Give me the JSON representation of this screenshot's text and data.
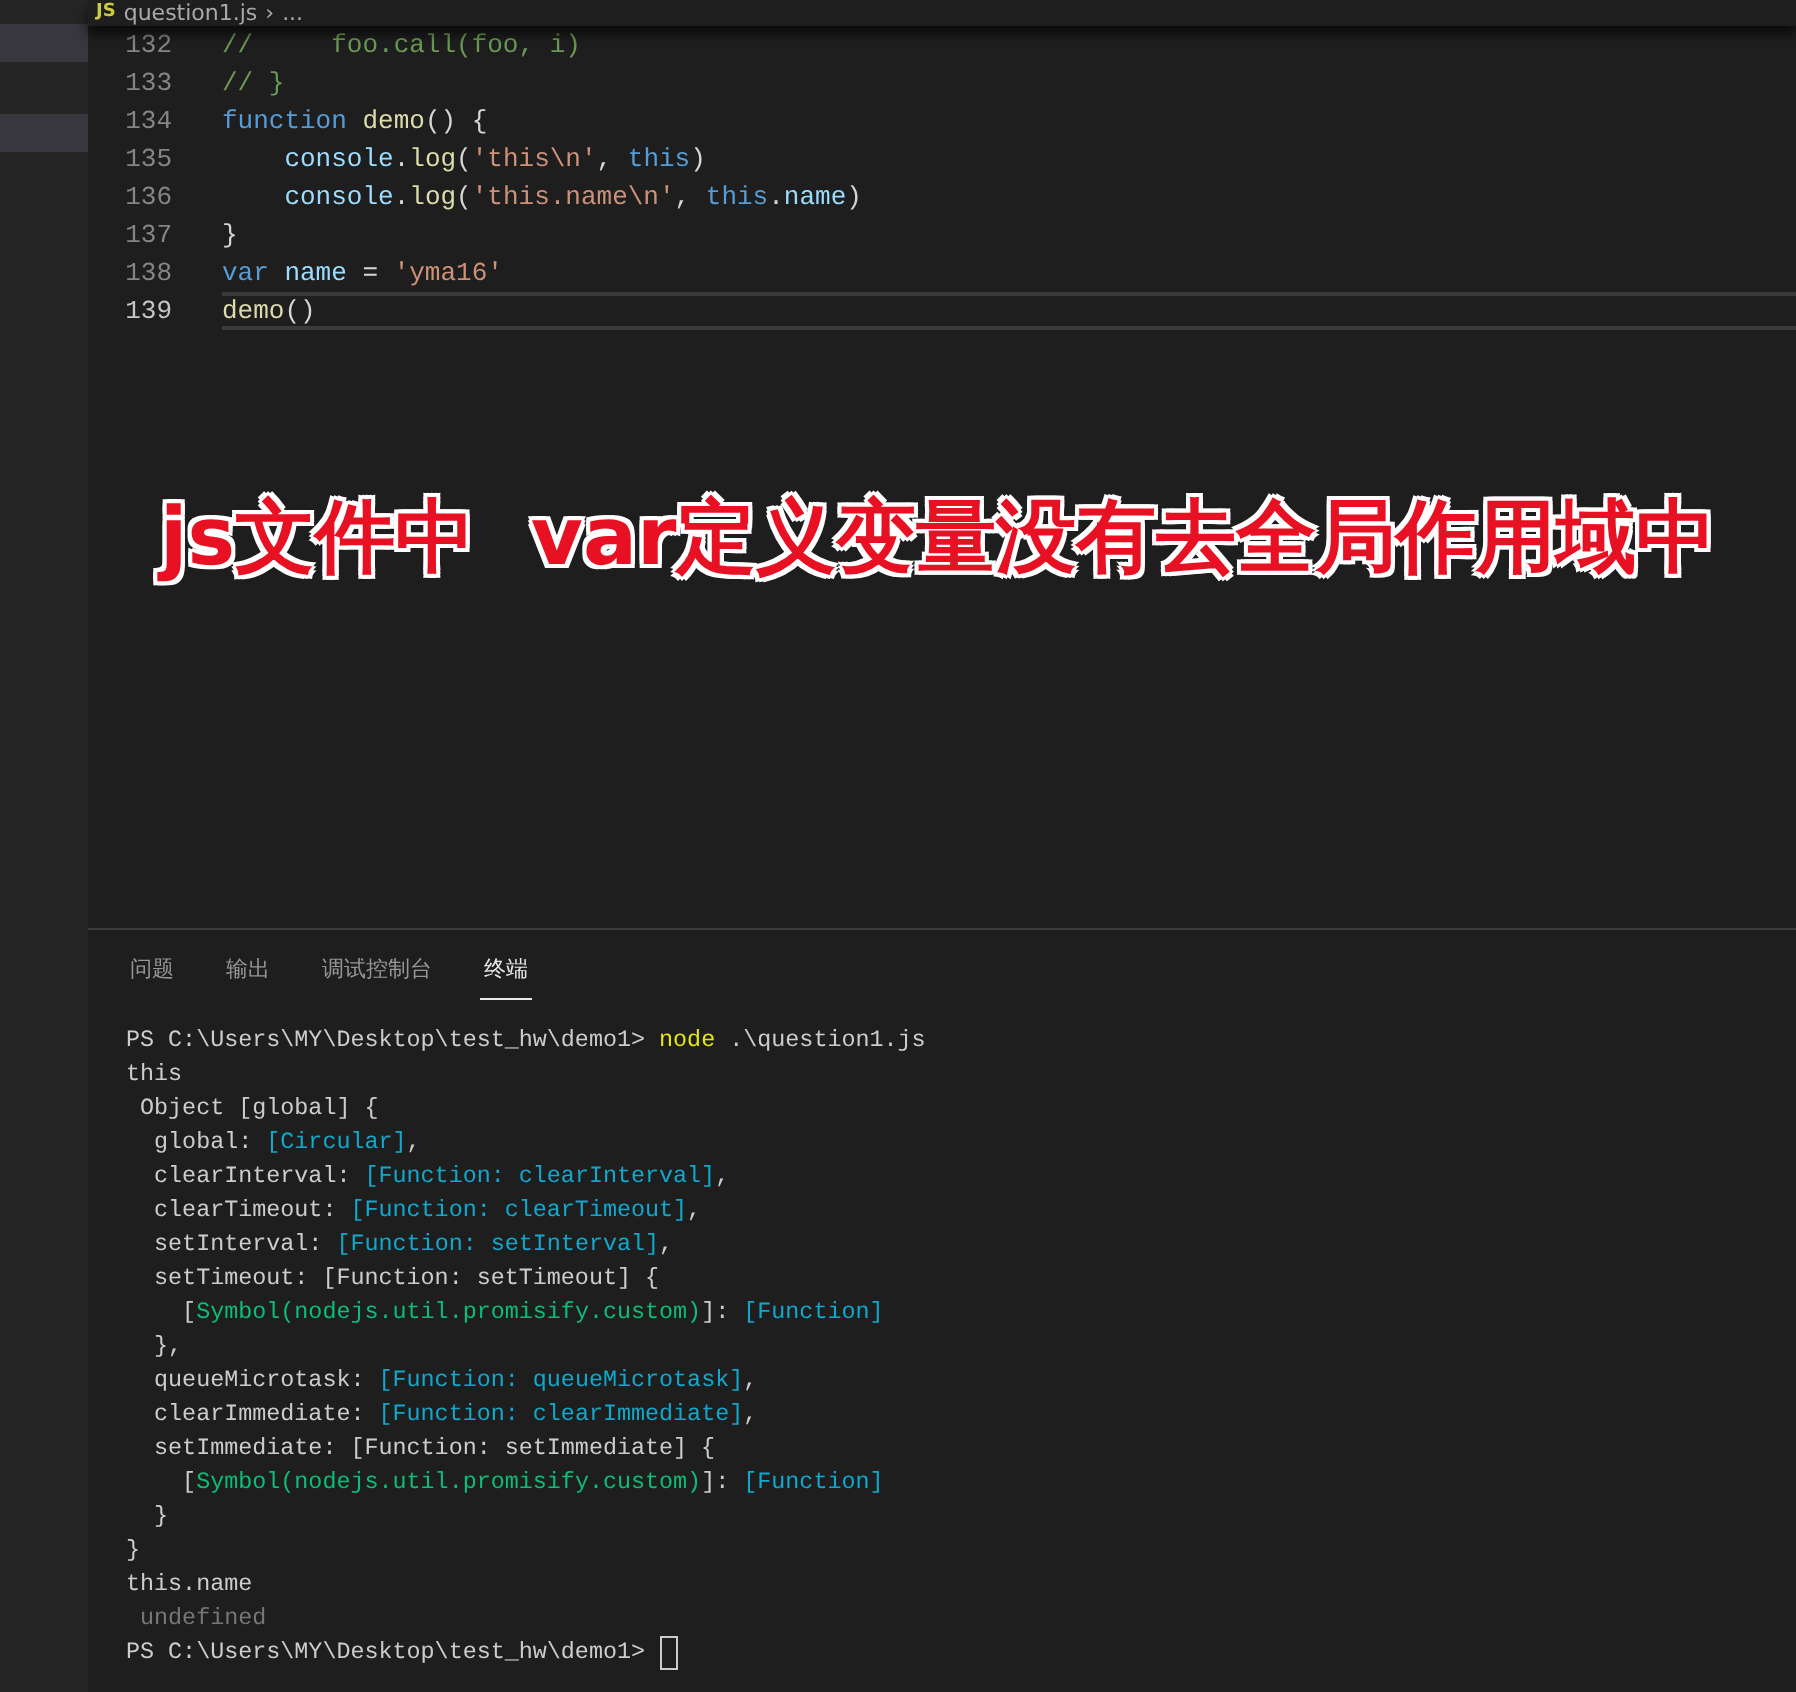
{
  "breadcrumb": {
    "icon": "JS",
    "file": "question1.js",
    "separator": "›",
    "more": "..."
  },
  "editor": {
    "lines": [
      {
        "number": "132",
        "current": false,
        "tokens": [
          {
            "kind": "comment",
            "text": "//     foo.call(foo, i)"
          }
        ]
      },
      {
        "number": "133",
        "current": false,
        "tokens": [
          {
            "kind": "comment",
            "text": "// }"
          }
        ]
      },
      {
        "number": "134",
        "current": false,
        "tokens": [
          {
            "kind": "keyword",
            "text": "function"
          },
          {
            "kind": "func",
            "text": " demo"
          },
          {
            "kind": "plain",
            "text": "() {"
          }
        ]
      },
      {
        "number": "135",
        "current": false,
        "tokens": [
          {
            "kind": "var",
            "text": "    console"
          },
          {
            "kind": "plain",
            "text": "."
          },
          {
            "kind": "func",
            "text": "log"
          },
          {
            "kind": "plain",
            "text": "("
          },
          {
            "kind": "string",
            "text": "'this\\n'"
          },
          {
            "kind": "plain",
            "text": ", "
          },
          {
            "kind": "keyword",
            "text": "this"
          },
          {
            "kind": "plain",
            "text": ")"
          }
        ]
      },
      {
        "number": "136",
        "current": false,
        "tokens": [
          {
            "kind": "var",
            "text": "    console"
          },
          {
            "kind": "plain",
            "text": "."
          },
          {
            "kind": "func",
            "text": "log"
          },
          {
            "kind": "plain",
            "text": "("
          },
          {
            "kind": "string",
            "text": "'this.name\\n'"
          },
          {
            "kind": "plain",
            "text": ", "
          },
          {
            "kind": "keyword",
            "text": "this"
          },
          {
            "kind": "plain",
            "text": "."
          },
          {
            "kind": "var",
            "text": "name"
          },
          {
            "kind": "plain",
            "text": ")"
          }
        ]
      },
      {
        "number": "137",
        "current": false,
        "tokens": [
          {
            "kind": "plain",
            "text": "}"
          }
        ]
      },
      {
        "number": "138",
        "current": false,
        "tokens": [
          {
            "kind": "keyword",
            "text": "var"
          },
          {
            "kind": "var",
            "text": " name"
          },
          {
            "kind": "plain",
            "text": " = "
          },
          {
            "kind": "string",
            "text": "'yma16'"
          }
        ]
      },
      {
        "number": "139",
        "current": true,
        "tokens": [
          {
            "kind": "func",
            "text": "demo"
          },
          {
            "kind": "plain",
            "text": "()"
          }
        ]
      }
    ]
  },
  "annotation": "js文件中  var定义变量没有去全局作用域中",
  "panel": {
    "tabs": [
      {
        "label": "问题",
        "selected": false
      },
      {
        "label": "输出",
        "selected": false
      },
      {
        "label": "调试控制台",
        "selected": false
      },
      {
        "label": "终端",
        "selected": true
      }
    ],
    "terminal": [
      [
        {
          "kind": "plain",
          "text": "PS C:\\Users\\MY\\Desktop\\test_hw\\demo1> "
        },
        {
          "kind": "cmd",
          "text": "node"
        },
        {
          "kind": "plain",
          "text": " .\\question1.js"
        }
      ],
      [
        {
          "kind": "plain",
          "text": "this"
        }
      ],
      [
        {
          "kind": "plain",
          "text": " Object [global] {"
        }
      ],
      [
        {
          "kind": "plain",
          "text": "  global: "
        },
        {
          "kind": "cyan",
          "text": "[Circular]"
        },
        {
          "kind": "plain",
          "text": ","
        }
      ],
      [
        {
          "kind": "plain",
          "text": "  clearInterval: "
        },
        {
          "kind": "cyan",
          "text": "[Function: clearInterval]"
        },
        {
          "kind": "plain",
          "text": ","
        }
      ],
      [
        {
          "kind": "plain",
          "text": "  clearTimeout: "
        },
        {
          "kind": "cyan",
          "text": "[Function: clearTimeout]"
        },
        {
          "kind": "plain",
          "text": ","
        }
      ],
      [
        {
          "kind": "plain",
          "text": "  setInterval: "
        },
        {
          "kind": "cyan",
          "text": "[Function: setInterval]"
        },
        {
          "kind": "plain",
          "text": ","
        }
      ],
      [
        {
          "kind": "plain",
          "text": "  setTimeout: [Function: setTimeout] {"
        }
      ],
      [
        {
          "kind": "plain",
          "text": "    ["
        },
        {
          "kind": "green",
          "text": "Symbol(nodejs.util.promisify.custom)"
        },
        {
          "kind": "plain",
          "text": "]: "
        },
        {
          "kind": "cyan",
          "text": "[Function]"
        }
      ],
      [
        {
          "kind": "plain",
          "text": "  },"
        }
      ],
      [
        {
          "kind": "plain",
          "text": "  queueMicrotask: "
        },
        {
          "kind": "cyan",
          "text": "[Function: queueMicrotask]"
        },
        {
          "kind": "plain",
          "text": ","
        }
      ],
      [
        {
          "kind": "plain",
          "text": "  clearImmediate: "
        },
        {
          "kind": "cyan",
          "text": "[Function: clearImmediate]"
        },
        {
          "kind": "plain",
          "text": ","
        }
      ],
      [
        {
          "kind": "plain",
          "text": "  setImmediate: [Function: setImmediate] {"
        }
      ],
      [
        {
          "kind": "plain",
          "text": "    ["
        },
        {
          "kind": "green",
          "text": "Symbol(nodejs.util.promisify.custom)"
        },
        {
          "kind": "plain",
          "text": "]: "
        },
        {
          "kind": "cyan",
          "text": "[Function]"
        }
      ],
      [
        {
          "kind": "plain",
          "text": "  }"
        }
      ],
      [
        {
          "kind": "plain",
          "text": "}"
        }
      ],
      [
        {
          "kind": "plain",
          "text": "this.name"
        }
      ],
      [
        {
          "kind": "dim",
          "text": " undefined"
        }
      ],
      [
        {
          "kind": "plain",
          "text": "PS C:\\Users\\MY\\Desktop\\test_hw\\demo1> "
        },
        {
          "kind": "cursor"
        }
      ]
    ]
  }
}
